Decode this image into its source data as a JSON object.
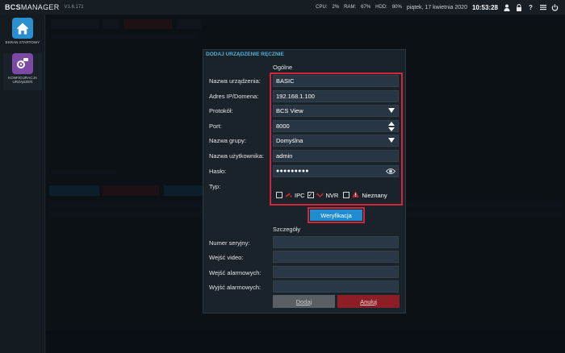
{
  "app": {
    "logo_bold": "BCS",
    "logo_light": "MANAGER",
    "version": "V1.6.171"
  },
  "status": {
    "cpu_label": "CPU:",
    "cpu_value": "2%",
    "ram_label": "RAM:",
    "ram_value": "67%",
    "hdd_label": "HDD:",
    "hdd_value": "80%",
    "date": "piątek, 17 kwietnia 2020",
    "time": "10:53:28",
    "icons": [
      "user-icon",
      "lock-icon",
      "help-icon",
      "menu-icon",
      "power-icon"
    ]
  },
  "sidebar": {
    "items": [
      {
        "label": "EKRAN STARTOWY",
        "icon": "home-icon",
        "color": "#2a8fce"
      },
      {
        "label": "KONFIGURACJA URZĄDZEŃ",
        "icon": "config-icon",
        "color": "#7c4aa6"
      }
    ]
  },
  "dialog": {
    "title": "DODAJ URZĄDZENIE RĘCZNIE",
    "general_section": "Ogólne",
    "fields": {
      "device_name": {
        "label": "Nazwa urządzenia:",
        "value": "BASIC"
      },
      "ip_address": {
        "label": "Adres IP/Domena:",
        "value": "192.168.1.100"
      },
      "protocol": {
        "label": "Protokół:",
        "value": "BCS View"
      },
      "port": {
        "label": "Port:",
        "value": "8000"
      },
      "group": {
        "label": "Nazwa grupy:",
        "value": "Domyślna"
      },
      "username": {
        "label": "Nazwa użytkownika:",
        "value": "admin"
      },
      "password": {
        "label": "Hasło:",
        "value": "●●●●●●●●●"
      },
      "type": {
        "label": "Typ:"
      }
    },
    "type_options": [
      {
        "label": "IPC",
        "checked": false
      },
      {
        "label": "NVR",
        "checked": true
      },
      {
        "label": "Nieznany",
        "checked": false
      }
    ],
    "verify_label": "Weryfikacja",
    "details_section": "Szczegóły",
    "details": {
      "serial": {
        "label": "Numer seryjny:"
      },
      "video_inputs": {
        "label": "Wejść video:"
      },
      "alarm_inputs": {
        "label": "Wejść alarmowych:"
      },
      "alarm_outputs": {
        "label": "Wyjść alarmowych:"
      }
    },
    "add_label": "Dodaj",
    "cancel_label": "Anuluj"
  },
  "colors": {
    "accent": "#1f8ccf",
    "highlight": "#d3263a",
    "cancel": "#8c1e26"
  }
}
